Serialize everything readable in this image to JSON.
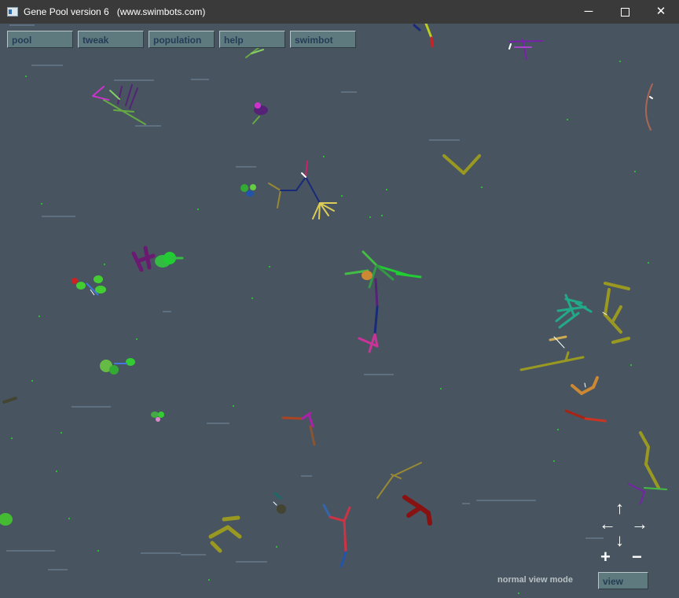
{
  "window": {
    "title": "Gene Pool version 6   (www.swimbots.com)",
    "controls": {
      "minimize": "─",
      "close": "✕"
    }
  },
  "menu": {
    "pool": "pool",
    "tweak": "tweak",
    "population": "population",
    "help": "help",
    "swimbot": "swimbot"
  },
  "status": {
    "mode": "normal view mode"
  },
  "view_button": "view",
  "nav": {
    "up": "↑",
    "down": "↓",
    "left": "←",
    "right": "→",
    "zoom_in": "+",
    "zoom_out": "−"
  },
  "colors": {
    "background": "#485560",
    "button_face": "#5f7a7e",
    "button_text": "#253b56",
    "food": "#22dd22"
  }
}
